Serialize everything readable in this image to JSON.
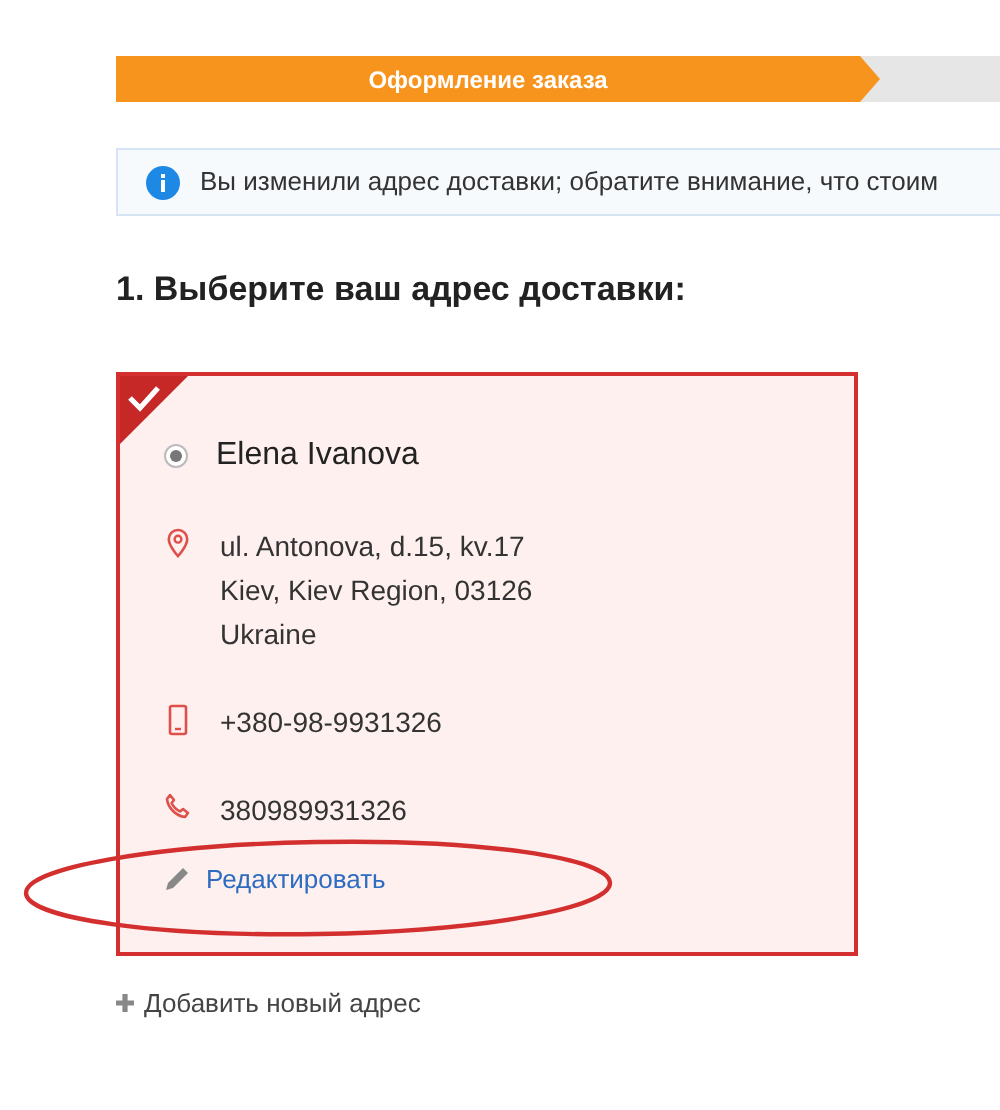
{
  "steps": [
    {
      "label": "Оформление заказа",
      "active": true
    }
  ],
  "notice": {
    "text": "Вы изменили адрес доставки; обратите внимание, что стоим"
  },
  "heading": "1. Выберите ваш адрес доставки:",
  "addresses": [
    {
      "selected": true,
      "name": "Elena Ivanova",
      "contacts": [
        {
          "kind": "address",
          "lines": [
            "ul. Antonova, d.15, kv.17",
            "Kiev, Kiev Region, 03126",
            "Ukraine"
          ]
        },
        {
          "kind": "mobile",
          "lines": [
            "+380-98-9931326"
          ]
        },
        {
          "kind": "phone",
          "lines": [
            "380989931326"
          ]
        }
      ],
      "edit_link": "Редактировать"
    }
  ],
  "add_link": "Добавить новый адрес",
  "annotation": {
    "circled": true
  }
}
